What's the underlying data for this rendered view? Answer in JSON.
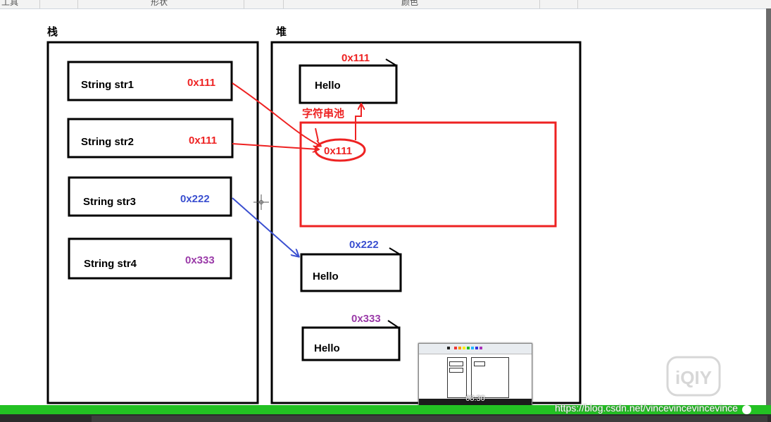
{
  "toolbar": {
    "items": [
      "工具",
      "形状",
      "颜色"
    ]
  },
  "stack": {
    "title": "栈",
    "vars": [
      {
        "name": "String str1",
        "address": "0x111",
        "color": "#ee2222"
      },
      {
        "name": "String str2",
        "address": "0x111",
        "color": "#ee2222"
      },
      {
        "name": "String str3",
        "address": "0x222",
        "color": "#3a4fd0"
      },
      {
        "name": "String str4",
        "address": "0x333",
        "color": "#9a3aa8"
      }
    ]
  },
  "heap": {
    "title": "堆",
    "objects": [
      {
        "value": "Hello",
        "address": "0x111",
        "color": "#ee2222"
      },
      {
        "value": "Hello",
        "address": "0x222",
        "color": "#3a4fd0"
      },
      {
        "value": "Hello",
        "address": "0x333",
        "color": "#9a3aa8"
      }
    ],
    "pool": {
      "label": "字符串池",
      "entry": "0x111",
      "color": "#ee2222"
    }
  },
  "player": {
    "thumbnail_time": "08:30",
    "watermark_url": "https://blog.csdn.net/vincevincevincevince",
    "logo_text": "iQIY",
    "progress_fraction": 0.97
  },
  "colors": {
    "red": "#ee2222",
    "blue": "#3a4fd0",
    "purple": "#9a3aa8",
    "progress": "#23c123"
  }
}
